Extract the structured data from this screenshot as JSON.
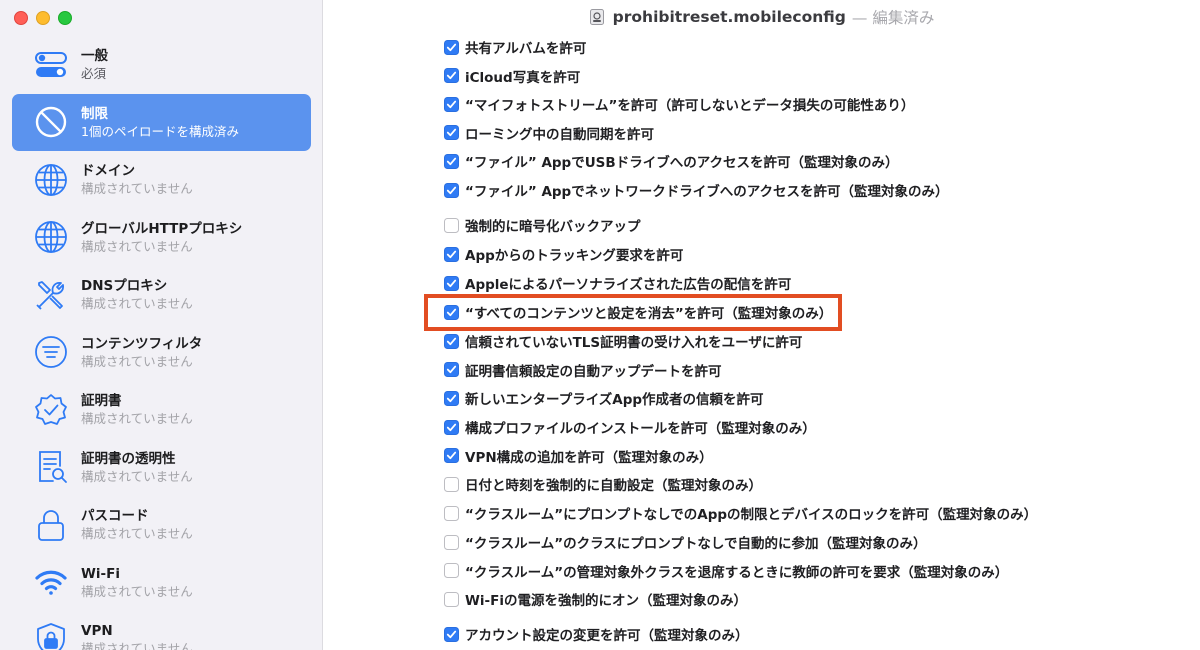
{
  "window": {
    "document_name": "prohibitreset.mobileconfig",
    "edited_suffix": "— 編集済み"
  },
  "sidebar": {
    "items": [
      {
        "title": "一般",
        "subtitle": "必須",
        "icon": "toggle-switches-icon"
      },
      {
        "title": "制限",
        "subtitle": "1個のペイロードを構成済み",
        "icon": "prohibited-icon"
      },
      {
        "title": "ドメイン",
        "subtitle": "構成されていません",
        "icon": "globe-icon"
      },
      {
        "title": "グローバルHTTPプロキシ",
        "subtitle": "構成されていません",
        "icon": "globe-icon"
      },
      {
        "title": "DNSプロキシ",
        "subtitle": "構成されていません",
        "icon": "tools-icon"
      },
      {
        "title": "コンテンツフィルタ",
        "subtitle": "構成されていません",
        "icon": "filter-icon"
      },
      {
        "title": "証明書",
        "subtitle": "構成されていません",
        "icon": "certificate-badge-icon"
      },
      {
        "title": "証明書の透明性",
        "subtitle": "構成されていません",
        "icon": "document-magnifier-icon"
      },
      {
        "title": "パスコード",
        "subtitle": "構成されていません",
        "icon": "lock-icon"
      },
      {
        "title": "Wi-Fi",
        "subtitle": "構成されていません",
        "icon": "wifi-icon"
      },
      {
        "title": "VPN",
        "subtitle": "構成されていません",
        "icon": "vpn-lock-icon"
      }
    ]
  },
  "options": [
    {
      "label": "共有アルバムを許可",
      "checked": true
    },
    {
      "label": "iCloud写真を許可",
      "checked": true
    },
    {
      "label": "“マイフォトストリーム”を許可（許可しないとデータ損失の可能性あり）",
      "checked": true
    },
    {
      "label": "ローミング中の自動同期を許可",
      "checked": true
    },
    {
      "label": "“ファイル” AppでUSBドライブへのアクセスを許可（監理対象のみ）",
      "checked": true
    },
    {
      "label": "“ファイル” Appでネットワークドライブへのアクセスを許可（監理対象のみ）",
      "checked": true
    },
    {
      "label": "強制的に暗号化バックアップ",
      "checked": false
    },
    {
      "label": "Appからのトラッキング要求を許可",
      "checked": true
    },
    {
      "label": "Appleによるパーソナライズされた広告の配信を許可",
      "checked": true
    },
    {
      "label": "“すべてのコンテンツと設定を消去”を許可（監理対象のみ）",
      "checked": true,
      "highlighted": true
    },
    {
      "label": "信頼されていないTLS証明書の受け入れをユーザに許可",
      "checked": true
    },
    {
      "label": "証明書信頼設定の自動アップデートを許可",
      "checked": true
    },
    {
      "label": "新しいエンタープライズApp作成者の信頼を許可",
      "checked": true
    },
    {
      "label": "構成プロファイルのインストールを許可（監理対象のみ）",
      "checked": true
    },
    {
      "label": "VPN構成の追加を許可（監理対象のみ）",
      "checked": true
    },
    {
      "label": "日付と時刻を強制的に自動設定（監理対象のみ）",
      "checked": false
    },
    {
      "label": "“クラスルーム”にプロンプトなしでのAppの制限とデバイスのロックを許可（監理対象のみ）",
      "checked": false
    },
    {
      "label": "“クラスルーム”のクラスにプロンプトなしで自動的に参加（監理対象のみ）",
      "checked": false
    },
    {
      "label": "“クラスルーム”の管理対象外クラスを退席するときに教師の許可を要求（監理対象のみ）",
      "checked": false
    },
    {
      "label": "Wi-Fiの電源を強制的にオン（監理対象のみ）",
      "checked": false
    },
    {
      "label": "アカウント設定の変更を許可（監理対象のみ）",
      "checked": true
    }
  ],
  "colors": {
    "accent": "#2f7bf5",
    "sidebar_selected": "#5b93ee",
    "highlight_border": "#e24d22"
  }
}
